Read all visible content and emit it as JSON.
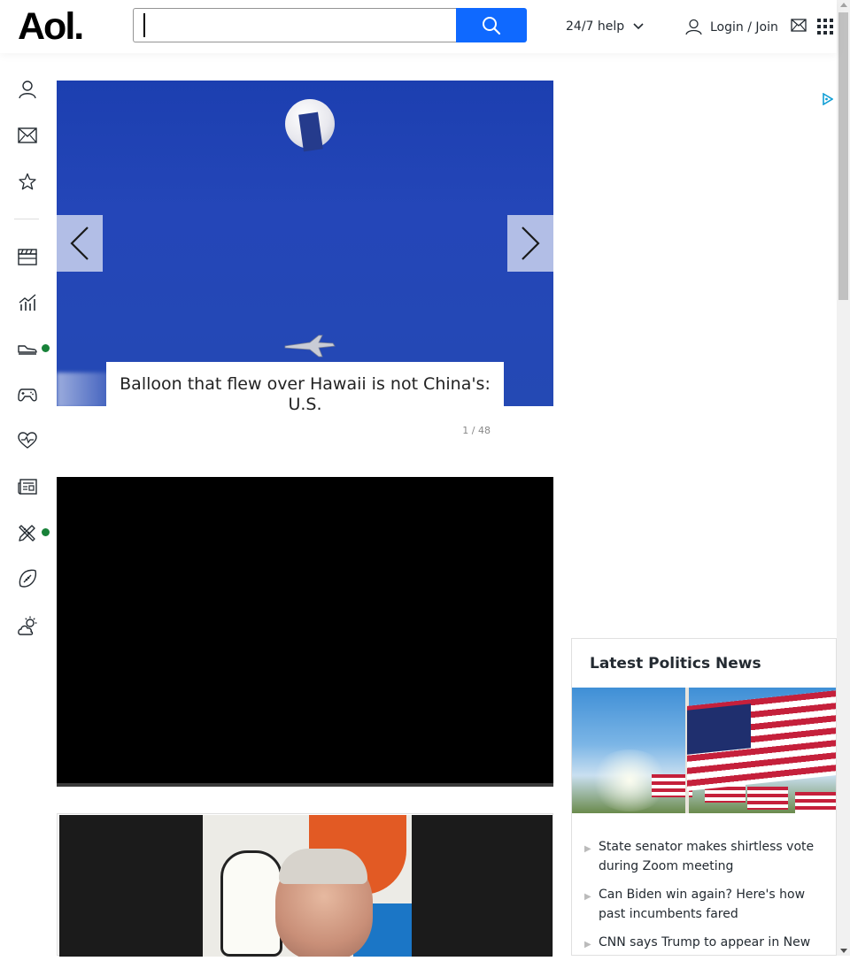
{
  "header": {
    "logo_text": "Aol.",
    "search_placeholder": "",
    "help_label": "24/7 help",
    "login_label": "Login / Join",
    "icons": [
      "search-icon",
      "chevron-down-icon",
      "user-icon",
      "mail-icon",
      "apps-grid-icon"
    ]
  },
  "rail": {
    "items": [
      {
        "name": "profile",
        "icon": "user-icon",
        "badge": false
      },
      {
        "name": "mail",
        "icon": "mail-icon",
        "badge": false
      },
      {
        "name": "favorites",
        "icon": "star-icon",
        "badge": false
      },
      {
        "name": "entertainment",
        "icon": "clapperboard-icon",
        "badge": false
      },
      {
        "name": "finance",
        "icon": "chart-icon",
        "badge": false
      },
      {
        "name": "shopping",
        "icon": "sneaker-icon",
        "badge": true
      },
      {
        "name": "games",
        "icon": "gamepad-icon",
        "badge": false
      },
      {
        "name": "health",
        "icon": "heart-icon",
        "badge": false
      },
      {
        "name": "news",
        "icon": "newspaper-icon",
        "badge": false
      },
      {
        "name": "lifestyle",
        "icon": "pencil-ruler-icon",
        "badge": true
      },
      {
        "name": "sports",
        "icon": "football-icon",
        "badge": false
      },
      {
        "name": "weather",
        "icon": "weather-icon",
        "badge": false
      }
    ],
    "badge_color": "#188239"
  },
  "slideshow": {
    "caption": "Balloon that flew over Hawaii is not China's: U.S.",
    "counter": "1 / 48",
    "icons": [
      "chevron-left-icon",
      "chevron-right-icon"
    ]
  },
  "politics": {
    "title": "Latest Politics News",
    "items": [
      "State senator makes shirtless vote during Zoom meeting",
      "Can Biden win again? Here's how past incumbents fared",
      "CNN says Trump to appear in New"
    ]
  },
  "colors": {
    "accent": "#0f69ff",
    "text": "#232a31"
  }
}
